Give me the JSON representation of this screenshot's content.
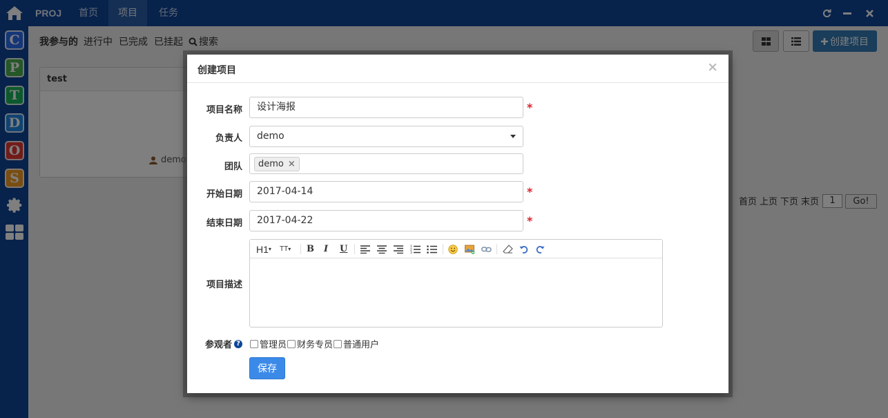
{
  "rail": {
    "apps": [
      {
        "letter": "C",
        "color": "#2a6cf0",
        "icon": "app-c-icon"
      },
      {
        "letter": "P",
        "color": "#4caf50",
        "icon": "app-p-icon"
      },
      {
        "letter": "T",
        "color": "#1bb35a",
        "icon": "app-t-icon"
      },
      {
        "letter": "D",
        "color": "#1e88e5",
        "icon": "app-d-icon"
      },
      {
        "letter": "O",
        "color": "#e53935",
        "icon": "app-o-icon"
      },
      {
        "letter": "S",
        "color": "#f59a23",
        "icon": "app-s-icon"
      }
    ]
  },
  "topbar": {
    "brand": "PROJ",
    "nav": [
      "首页",
      "项目",
      "任务"
    ],
    "active_nav": "项目"
  },
  "subbar": {
    "filters": [
      "我参与的",
      "进行中",
      "已完成",
      "已挂起"
    ],
    "search": "搜索",
    "create": "创建项目"
  },
  "card": {
    "title": "test",
    "owner": "demo"
  },
  "pager": {
    "first": "首页",
    "prev": "上页",
    "next": "下页",
    "last": "末页",
    "page": "1",
    "go": "Go!"
  },
  "modal": {
    "title": "创建项目",
    "close": "×",
    "fields": {
      "name_label": "项目名称",
      "name_value": "设计海报",
      "owner_label": "负责人",
      "owner_value": "demo",
      "team_label": "团队",
      "team_tag": "demo",
      "start_label": "开始日期",
      "start_value": "2017-04-14",
      "end_label": "结束日期",
      "end_value": "2017-04-22",
      "desc_label": "项目描述",
      "required_mark": "*"
    },
    "toolbar": {
      "heading": "H1",
      "font_size": "TT",
      "bold": "B",
      "italic": "I",
      "underline": "U"
    },
    "viewers": {
      "label": "参观者",
      "options": [
        "管理员",
        "财务专员",
        "普通用户"
      ]
    },
    "save": "保存"
  }
}
